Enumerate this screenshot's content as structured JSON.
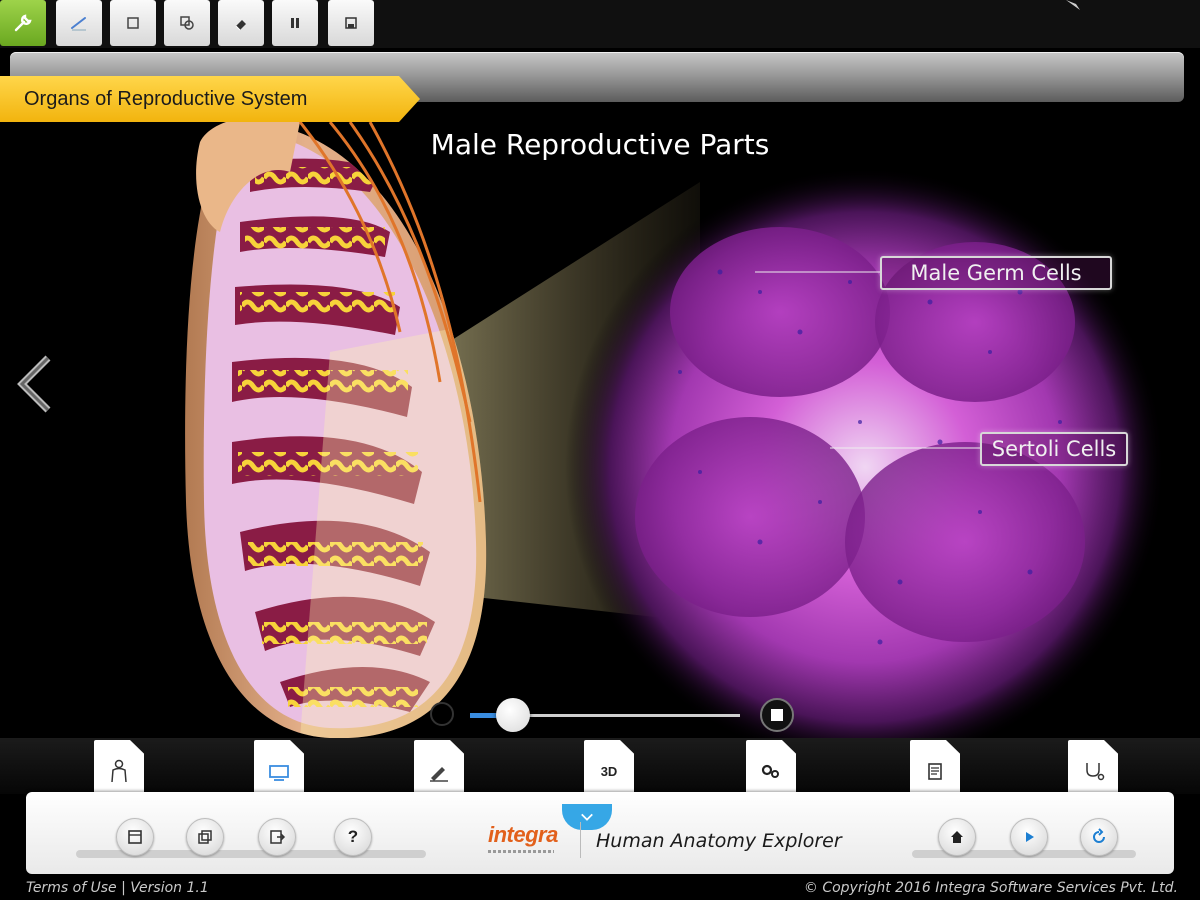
{
  "toolbar": {
    "tools": [
      {
        "icon": "wrench-icon",
        "active": true
      },
      {
        "icon": "pen-icon",
        "active": false
      },
      {
        "icon": "square-icon",
        "active": false
      },
      {
        "icon": "shapes-icon",
        "active": false
      },
      {
        "icon": "eraser-icon",
        "active": false
      },
      {
        "icon": "pause-icon",
        "active": false
      },
      {
        "icon": "save-icon",
        "active": false
      }
    ],
    "accent": "#7ab929"
  },
  "header": {
    "section_title": "Organs of Reproductive System",
    "ribbon_color": "#f5be1c"
  },
  "stage": {
    "title": "Male Reproductive Parts",
    "labels": {
      "germ_cells": "Male Germ Cells",
      "sertoli_cells": "Sertoli Cells"
    },
    "playback_progress": 0.16
  },
  "tabs": [
    {
      "icon": "body-figure-icon"
    },
    {
      "icon": "display-icon"
    },
    {
      "icon": "pencil-ruler-icon"
    },
    {
      "icon": "three-d-icon",
      "label": "3D"
    },
    {
      "icon": "gears-icon"
    },
    {
      "icon": "document-icon"
    },
    {
      "icon": "stethoscope-icon"
    }
  ],
  "panel": {
    "left_buttons": [
      "layout-icon",
      "copy-icon",
      "export-icon",
      "help-icon"
    ],
    "help_glyph": "?",
    "brand": "integra",
    "app_title": "Human Anatomy Explorer",
    "right_buttons": [
      "home-icon",
      "play-icon",
      "refresh-icon"
    ],
    "accent": "#36a7e6"
  },
  "footer": {
    "left": "Terms of Use |  Version 1.1",
    "right": "© Copyright 2016 Integra Software Services Pvt. Ltd."
  }
}
